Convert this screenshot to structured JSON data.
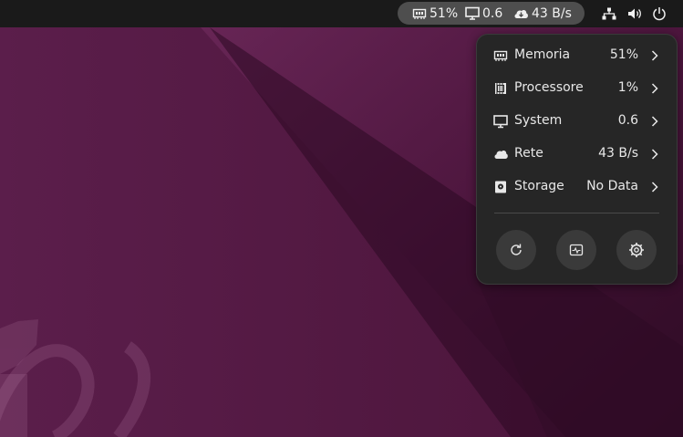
{
  "topbar": {
    "indicators": [
      {
        "icon": "memory-chip-icon",
        "value": "51%"
      },
      {
        "icon": "monitor-icon",
        "value": "0.6"
      },
      {
        "icon": "cloud-download-icon",
        "value": "43 B/s"
      }
    ],
    "tray": [
      {
        "icon": "network-wired-icon"
      },
      {
        "icon": "volume-icon"
      },
      {
        "icon": "power-icon"
      }
    ]
  },
  "menu": {
    "items": [
      {
        "icon": "memory-chip-icon",
        "label": "Memoria",
        "value": "51%"
      },
      {
        "icon": "processor-icon",
        "label": "Processore",
        "value": "1%"
      },
      {
        "icon": "monitor-icon",
        "label": "System",
        "value": "0.6"
      },
      {
        "icon": "cloud-icon",
        "label": "Rete",
        "value": "43 B/s"
      },
      {
        "icon": "storage-disk-icon",
        "label": "Storage",
        "value": "No Data"
      }
    ],
    "buttons": [
      {
        "icon": "refresh-icon"
      },
      {
        "icon": "system-monitor-icon"
      },
      {
        "icon": "settings-gear-icon"
      }
    ]
  },
  "colors": {
    "topbar": "#1a1a1a",
    "pill": "#4e4e4e",
    "menu_bg": "#262626",
    "button_bg": "#3a3a3a",
    "wallpaper": "#561a46"
  }
}
